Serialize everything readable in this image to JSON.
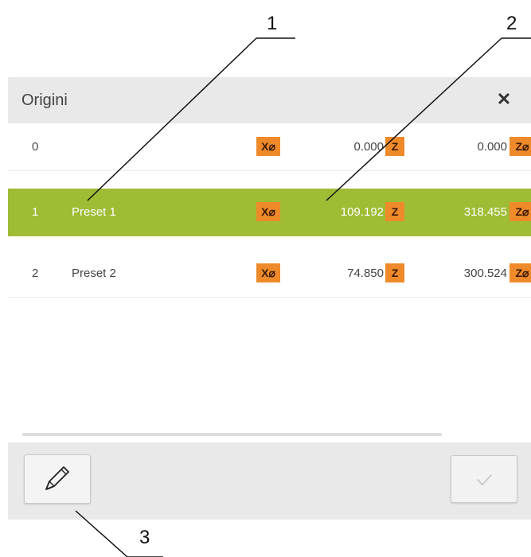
{
  "dialog": {
    "title": "Origini",
    "close_icon": "close-icon"
  },
  "presets": [
    {
      "index": "0",
      "name": "",
      "x_badge": "X⌀",
      "x_value": "0.000",
      "z_badge": "Z",
      "z_value": "0.000",
      "z2_badge": "Z⌀",
      "selected": false
    },
    {
      "index": "1",
      "name": "Preset 1",
      "x_badge": "X⌀",
      "x_value": "109.192",
      "z_badge": "Z",
      "z_value": "318.455",
      "z2_badge": "Z⌀",
      "selected": true
    },
    {
      "index": "2",
      "name": "Preset 2",
      "x_badge": "X⌀",
      "x_value": "74.850",
      "z_badge": "Z",
      "z_value": "300.524",
      "z2_badge": "Z⌀",
      "selected": false
    }
  ],
  "footer": {
    "edit_icon": "pencil-icon",
    "confirm_icon": "checkmark-icon"
  },
  "callouts": [
    "1",
    "2",
    "3"
  ],
  "colors": {
    "selected_row": "#9fbc35",
    "badge": "#ee8a2a",
    "header_bg": "#e9e9e9"
  }
}
